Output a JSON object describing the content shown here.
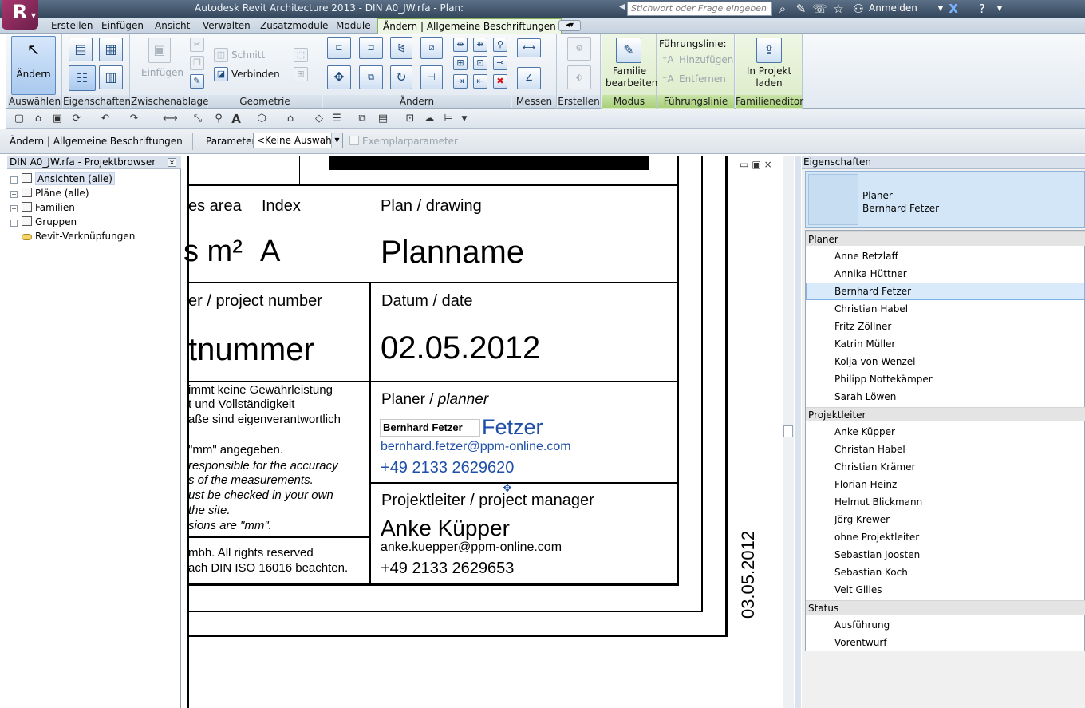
{
  "titlebar": {
    "title": "Autodesk Revit Architecture 2013 -     DIN A0_JW.rfa - Plan:",
    "search_placeholder": "Stichwort oder Frage eingeben",
    "login": "Anmelden"
  },
  "ribbon_tabs": [
    "Erstellen",
    "Einfügen",
    "Ansicht",
    "Verwalten",
    "Zusatzmodule",
    "Module"
  ],
  "active_tab": "Ändern | Allgemeine Beschriftungen",
  "panels": {
    "select": {
      "label": "Auswählen",
      "modify": "Ändern"
    },
    "properties": {
      "label": "Eigenschaften"
    },
    "clipboard": {
      "label": "Zwischenablage",
      "paste": "Einfügen"
    },
    "geometry": {
      "label": "Geometrie",
      "cut": "Schnitt",
      "join": "Verbinden"
    },
    "modify": {
      "label": "Ändern"
    },
    "measure": {
      "label": "Messen"
    },
    "create": {
      "label": "Erstellen"
    },
    "mode": {
      "label": "Modus",
      "edit_family": "Familie bearbeiten"
    },
    "leader": {
      "label": "Führungslinie",
      "title": "Führungslinie:",
      "add": "Hinzufügen",
      "remove": "Entfernen"
    },
    "family_editor": {
      "label": "Familieneditor",
      "load": "In Projekt laden"
    }
  },
  "options_bar": {
    "context": "Ändern | Allgemeine Beschriftungen",
    "parameter_label": "Parameter:",
    "parameter_value": "<Keine Auswahl>",
    "instance_param": "Exemplarparameter"
  },
  "browser": {
    "header": "DIN A0_JW.rfa - Projektbrowser",
    "items": [
      {
        "label": "Ansichten (alle)"
      },
      {
        "label": "Pläne (alle)"
      },
      {
        "label": "Familien"
      },
      {
        "label": "Gruppen"
      },
      {
        "label": "Revit-Verknüpfungen"
      }
    ]
  },
  "drawing": {
    "col_area": "es area",
    "col_index": "Index",
    "col_plan": "Plan / drawing",
    "area_value": "s m²",
    "index_value": "A",
    "plan_value": "Planname",
    "project_number_label": "er / project number",
    "project_number_value": "tnummer",
    "date_label": "Datum / date",
    "date_value": "02.05.2012",
    "disclaimer": [
      "immt keine Gewährleistung",
      "t  und Vollständigkeit",
      "aße sind eigenverantwortlich",
      "\"mm\" angegeben.",
      "responsible for the accuracy",
      "s of the measurements.",
      "ust be checked in your own",
      "the site.",
      "sions are \"mm\"."
    ],
    "copyright_1": "mbh. All rights reserved",
    "copyright_2": "ach DIN ISO 16016 beachten.",
    "planner_label": "Planer / ",
    "planner_label_italic": "planner",
    "planner_box": "Bernhard Fetzer",
    "planner_lastname": "Fetzer",
    "planner_email": "bernhard.fetzer@ppm-online.com",
    "planner_phone": "+49 2133 2629620",
    "pm_label": "Projektleiter / project manager",
    "pm_name": "Anke Küpper",
    "pm_email": "anke.kuepper@ppm-online.com",
    "pm_phone": "+49 2133 2629653",
    "side_date": "03.05.2012"
  },
  "properties": {
    "header": "Eigenschaften",
    "type_line1": "Planer",
    "type_line2": "Bernhard Fetzer",
    "groups": [
      {
        "name": "Planer",
        "items": [
          "Anne Retzlaff",
          "Annika Hüttner",
          "Bernhard Fetzer",
          "Christian Habel",
          "Fritz Zöllner",
          "Katrin Müller",
          "Kolja von Wenzel",
          "Philipp Nottekämper",
          "Sarah Löwen"
        ]
      },
      {
        "name": "Projektleiter",
        "items": [
          "Anke Küpper",
          "Christan Habel",
          "Christian Krämer",
          "Florian Heinz",
          "Helmut Blickmann",
          "Jörg Krewer",
          "ohne Projektleiter",
          "Sebastian Joosten",
          "Sebastian Koch",
          "Veit Gilles"
        ]
      },
      {
        "name": "Status",
        "items": [
          "Ausführung",
          "Vorentwurf"
        ]
      }
    ],
    "selected_item": "Bernhard Fetzer"
  },
  "colors": {
    "accent_blue": "#1f4fa8",
    "active_tab_green": "#86b357"
  }
}
